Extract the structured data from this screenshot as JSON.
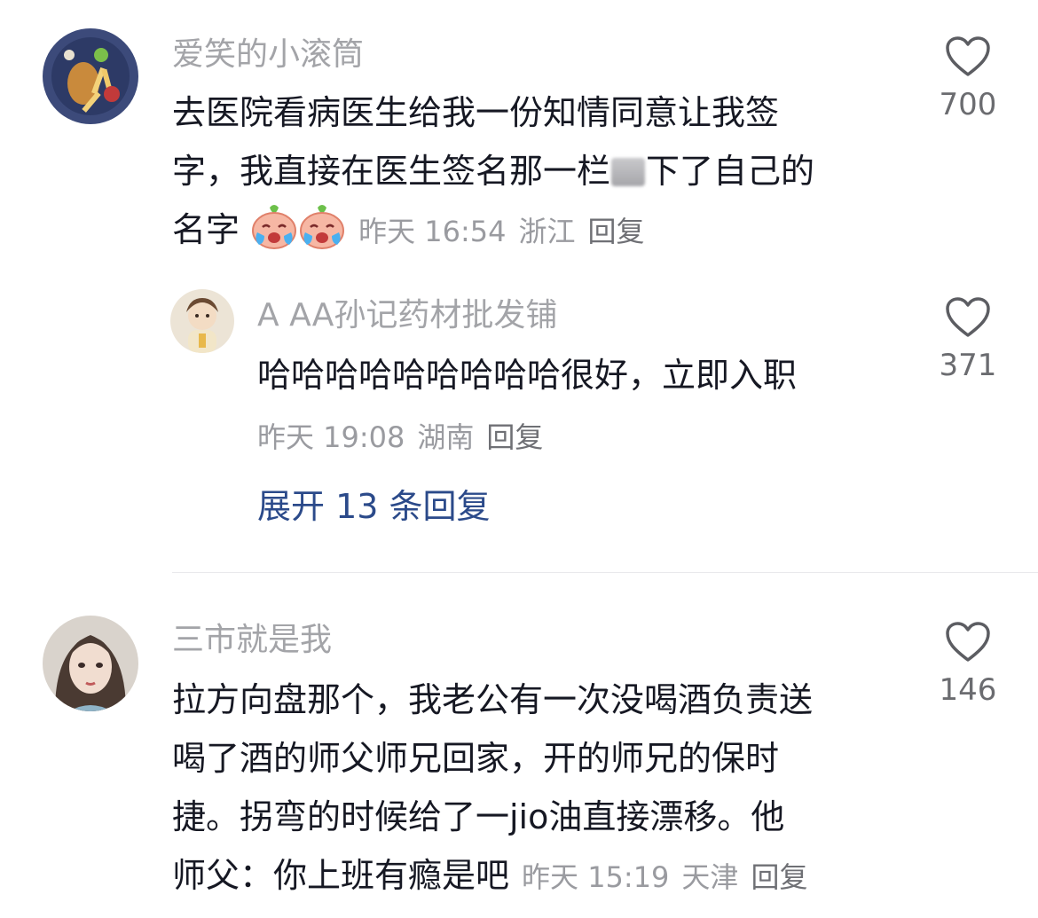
{
  "comments": [
    {
      "username": "爱笑的小滚筒",
      "text_line1": "去医院看病医生给我一份知情同意让我签",
      "text_line2_a": "字，我直接在医生签名那一栏",
      "text_line2_b": "下了自己的",
      "text_line3": "名字",
      "emoji": "crying-face-emoji",
      "time": "昨天 16:54",
      "location": "浙江",
      "reply_label": "回复",
      "likes": "700",
      "replies": [
        {
          "username": "A AA孙记药材批发铺",
          "text": "哈哈哈哈哈哈哈哈哈很好，立即入职",
          "time": "昨天 19:08",
          "location": "湖南",
          "reply_label": "回复",
          "likes": "371"
        }
      ],
      "expand_label": "展开 13 条回复"
    },
    {
      "username": "三市就是我",
      "text_line1": "拉方向盘那个，我老公有一次没喝酒负责送",
      "text_line2": "喝了酒的师父师兄回家，开的师兄的保时",
      "text_line3": "捷。拐弯的时候给了一jio油直接漂移。他",
      "text_line4": "师父：你上班有瘾是吧",
      "time": "昨天 15:19",
      "location": "天津",
      "reply_label": "回复",
      "likes": "146"
    }
  ],
  "colors": {
    "username": "#a3a4a8",
    "text": "#161823",
    "meta": "#9a9ba0",
    "expand_link": "#2b4a8a",
    "divider": "#e9e9ec"
  },
  "icons": {
    "like": "heart-outline-icon"
  }
}
